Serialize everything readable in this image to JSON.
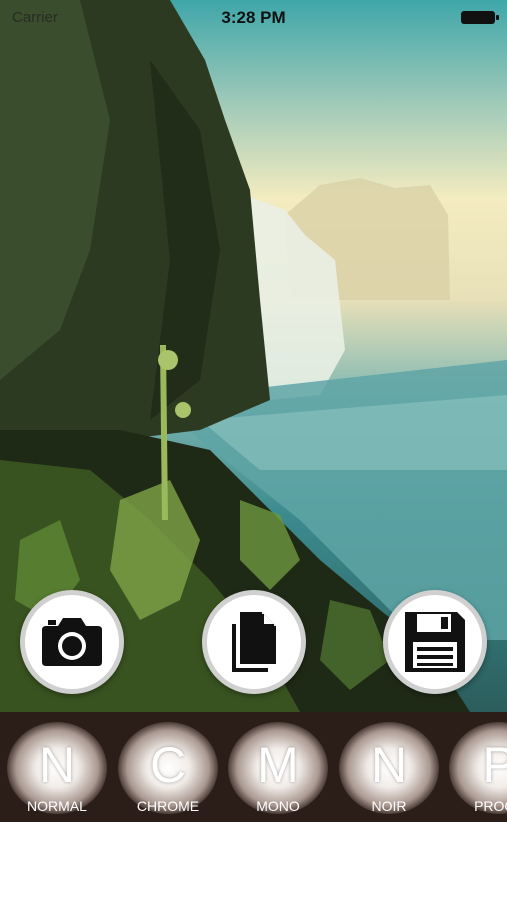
{
  "status_bar": {
    "carrier": "Carrier",
    "time": "3:28 PM",
    "battery_icon": "battery-icon"
  },
  "actions": [
    {
      "icon": "camera-icon"
    },
    {
      "icon": "document-icon"
    },
    {
      "icon": "floppy-disk-icon"
    }
  ],
  "filters": [
    {
      "letter": "N",
      "label": "NORMAL"
    },
    {
      "letter": "C",
      "label": "CHROME"
    },
    {
      "letter": "M",
      "label": "MONO"
    },
    {
      "letter": "N",
      "label": "NOIR"
    },
    {
      "letter": "P",
      "label": "PROCE"
    }
  ],
  "colors": {
    "filter_strip_bg": "#2b1d18",
    "button_bg": "#ffffff",
    "icon_color": "#111111"
  }
}
